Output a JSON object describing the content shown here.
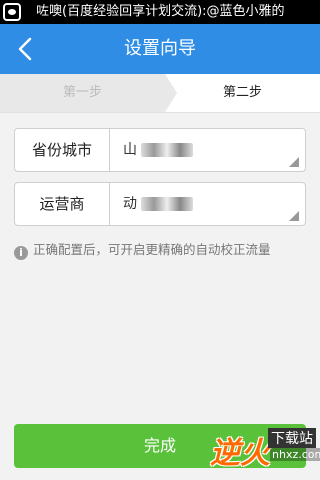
{
  "statusbar": {
    "ticker": "咗噢(百度经验回享计划交流):@蓝色小雅的"
  },
  "header": {
    "title": "设置向导"
  },
  "steps": [
    {
      "label": "第一步"
    },
    {
      "label": "第二步"
    }
  ],
  "form": {
    "province": {
      "label": "省份城市",
      "value": "山"
    },
    "operator": {
      "label": "运营商",
      "value": "动"
    }
  },
  "tip": {
    "text": "正确配置后，可开启更精确的自动校正流量"
  },
  "footer": {
    "done_label": "完成"
  },
  "watermark": {
    "logo": "逆火",
    "sub": "下载站",
    "url": "nhxz.com"
  },
  "colors": {
    "header_bg": "#2f8de6",
    "button_bg": "#5ac23a"
  }
}
